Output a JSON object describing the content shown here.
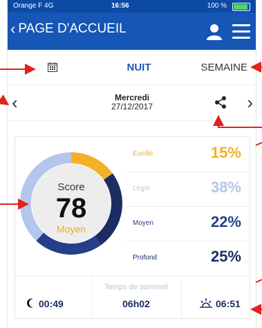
{
  "status_bar": {
    "carrier": "Orange F  4G",
    "time": "16:56",
    "battery": "100 %",
    "battery_level": 1.0
  },
  "nav": {
    "back_label": "PAGE D'ACCUEIL",
    "back_icon": "chevron-left-icon",
    "user_icon": "user-icon",
    "menu_icon": "hamburger-menu-icon"
  },
  "tabs": {
    "calendar_icon": "calendar-icon",
    "night_label": "NUIT",
    "week_label": "SEMAINE"
  },
  "date": {
    "day": "Mercredi",
    "date": "27/12/2017",
    "prev_icon": "chevron-left-icon",
    "next_icon": "chevron-right-icon",
    "share_icon": "share-icon"
  },
  "score": {
    "label": "Score",
    "value": "78",
    "level": "Moyen"
  },
  "stages": [
    {
      "name": "Eveillé",
      "percent": "15%",
      "value": 15,
      "color": "#f2b127"
    },
    {
      "name": "Léger",
      "percent": "38%",
      "value": 38,
      "color": "#b4c6ea"
    },
    {
      "name": "Moyen",
      "percent": "22%",
      "value": 22,
      "color": "#24408a"
    },
    {
      "name": "Profond",
      "percent": "25%",
      "value": 25,
      "color": "#1b2d63"
    }
  ],
  "sleep": {
    "bed_time": "00:49",
    "duration_label": "Temps de sommeil",
    "duration": "06h02",
    "wake_time": "06:51"
  },
  "colors": {
    "nav_blue": "#1556b6",
    "accent": "#1d57b8",
    "annotation_red": "#e0241c"
  }
}
